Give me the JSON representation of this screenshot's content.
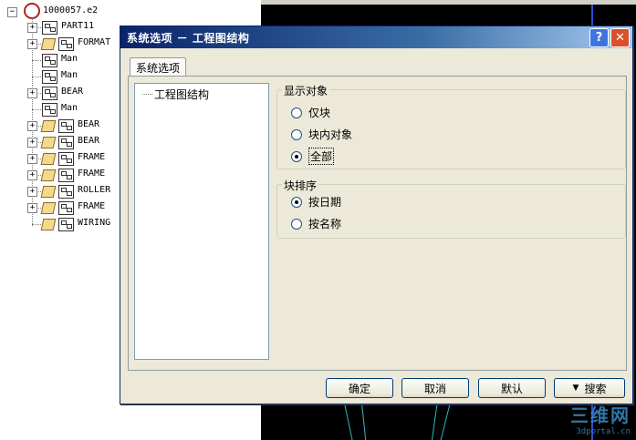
{
  "tree": {
    "root": "1000057.e2",
    "items": [
      {
        "label": "PART11",
        "expander": "+",
        "icons": [
          "part"
        ]
      },
      {
        "label": "FORMAT",
        "expander": "+",
        "icons": [
          "box",
          "part"
        ]
      },
      {
        "label": "Man",
        "expander": "",
        "icons": [
          "part"
        ]
      },
      {
        "label": "Man",
        "expander": "",
        "icons": [
          "part"
        ]
      },
      {
        "label": "BEAR",
        "expander": "+",
        "icons": [
          "part"
        ]
      },
      {
        "label": "Man",
        "expander": "",
        "icons": [
          "part"
        ]
      },
      {
        "label": "BEAR",
        "expander": "+",
        "icons": [
          "box",
          "part"
        ]
      },
      {
        "label": "BEAR",
        "expander": "+",
        "icons": [
          "box",
          "part"
        ]
      },
      {
        "label": "FRAME",
        "expander": "+",
        "icons": [
          "box",
          "part"
        ]
      },
      {
        "label": "FRAME",
        "expander": "+",
        "icons": [
          "box",
          "part"
        ]
      },
      {
        "label": "ROLLER",
        "expander": "+",
        "icons": [
          "box",
          "part"
        ]
      },
      {
        "label": "FRAME",
        "expander": "+",
        "icons": [
          "box",
          "part"
        ]
      },
      {
        "label": "WIRING",
        "expander": "",
        "icons": [
          "box",
          "part"
        ]
      }
    ]
  },
  "dialog": {
    "title": "系统选项 － 工程图结构",
    "help_glyph": "?",
    "close_glyph": "✕",
    "tab_label": "系统选项",
    "tree_item": "工程图结构",
    "display_group": {
      "title": "显示对象",
      "options": [
        {
          "label": "仅块",
          "checked": false
        },
        {
          "label": "块内对象",
          "checked": false
        },
        {
          "label": "全部",
          "checked": true
        }
      ]
    },
    "order_group": {
      "title": "块排序",
      "options": [
        {
          "label": "按日期",
          "checked": true
        },
        {
          "label": "按名称",
          "checked": false
        }
      ]
    },
    "buttons": {
      "ok": "确定",
      "cancel": "取消",
      "default": "默认",
      "search": "搜索",
      "search_chevron": "▼"
    }
  },
  "watermark": {
    "big": "三维网",
    "small": "3dportal.cn"
  },
  "colors": {
    "title_start": "#0a246a",
    "title_end": "#a6caf0",
    "cad_background": "#000000",
    "dialog_face": "#ece9d8"
  }
}
